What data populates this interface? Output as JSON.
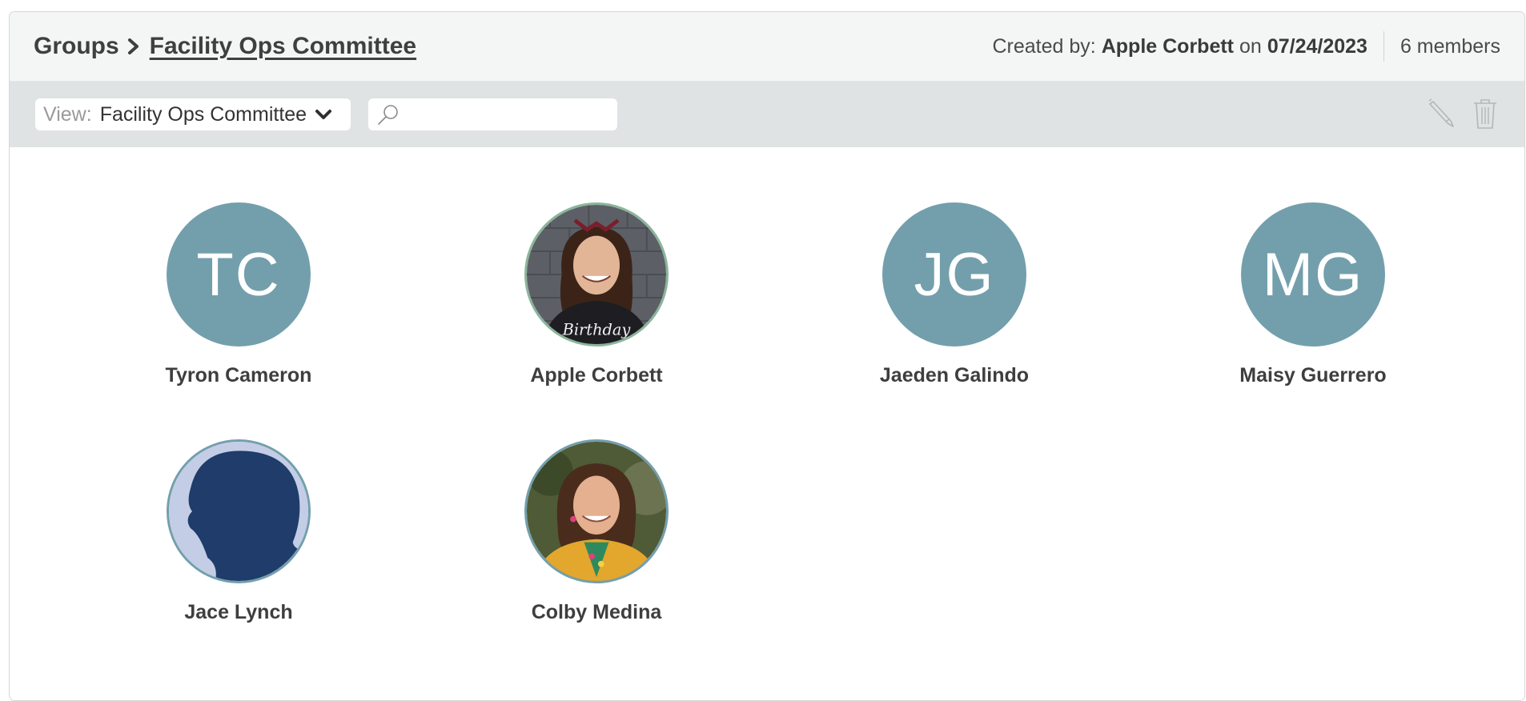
{
  "breadcrumb": {
    "root": "Groups",
    "current": "Facility Ops Committee"
  },
  "meta": {
    "created_by_label": "Created by:",
    "creator": "Apple Corbett",
    "on_label": "on",
    "date": "07/24/2023",
    "member_count": "6 members"
  },
  "toolbar": {
    "view_label": "View:",
    "view_value": "Facility Ops Committee",
    "search_placeholder": "",
    "edit_icon": "pencil-icon",
    "delete_icon": "trash-icon"
  },
  "members": [
    {
      "name": "Tyron Cameron",
      "initials": "TC",
      "photo": false
    },
    {
      "name": "Apple Corbett",
      "initials": "",
      "photo": true
    },
    {
      "name": "Jaeden Galindo",
      "initials": "JG",
      "photo": false
    },
    {
      "name": "Maisy Guerrero",
      "initials": "MG",
      "photo": false
    },
    {
      "name": "Jace Lynch",
      "initials": "",
      "photo": true
    },
    {
      "name": "Colby Medina",
      "initials": "",
      "photo": true
    }
  ],
  "colors": {
    "avatar_bg": "#739fac",
    "header_bg": "#f4f6f6",
    "toolbar_bg": "#dfe3e3"
  }
}
